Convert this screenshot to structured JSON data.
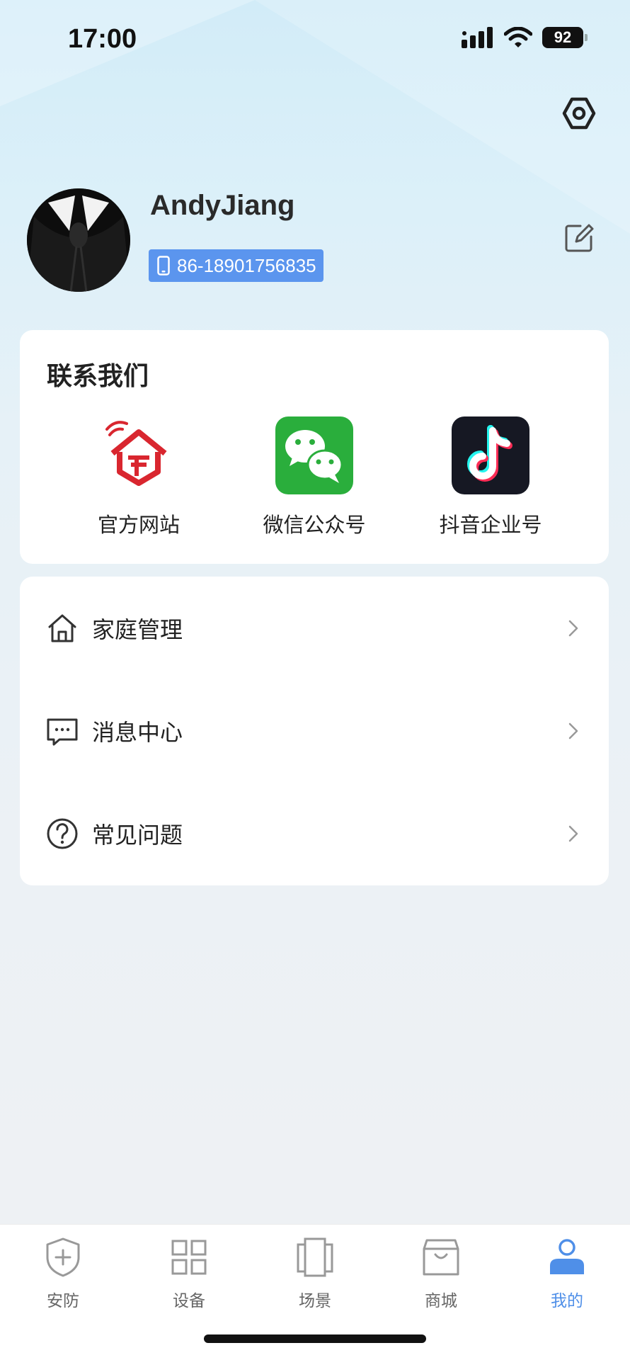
{
  "status_bar": {
    "time": "17:00",
    "battery": "92",
    "icons": [
      "signal-icon",
      "wifi-icon",
      "battery-icon"
    ]
  },
  "header": {
    "settings_icon": "settings-icon"
  },
  "profile": {
    "username": "AndyJiang",
    "phone": "86-18901756835",
    "phone_icon": "mobile-phone-icon",
    "edit_icon": "edit-icon"
  },
  "contact": {
    "title": "联系我们",
    "items": [
      {
        "label": "官方网站",
        "icon": "website-logo-icon"
      },
      {
        "label": "微信公众号",
        "icon": "wechat-icon"
      },
      {
        "label": "抖音企业号",
        "icon": "douyin-icon"
      }
    ]
  },
  "menu": {
    "items": [
      {
        "label": "家庭管理",
        "icon": "home-icon"
      },
      {
        "label": "消息中心",
        "icon": "message-icon"
      },
      {
        "label": "常见问题",
        "icon": "question-icon"
      }
    ]
  },
  "tab_bar": {
    "tabs": [
      {
        "label": "安防",
        "icon": "shield-icon",
        "active": false
      },
      {
        "label": "设备",
        "icon": "grid-icon",
        "active": false
      },
      {
        "label": "场景",
        "icon": "scene-icon",
        "active": false
      },
      {
        "label": "商城",
        "icon": "shopping-bag-icon",
        "active": false
      },
      {
        "label": "我的",
        "icon": "person-icon",
        "active": true
      }
    ]
  },
  "colors": {
    "accent": "#4f8fe8",
    "phone_badge": "#5b95ee",
    "wechat_green": "#2aae3c",
    "douyin_dark": "#161823",
    "website_red": "#d9262f"
  }
}
